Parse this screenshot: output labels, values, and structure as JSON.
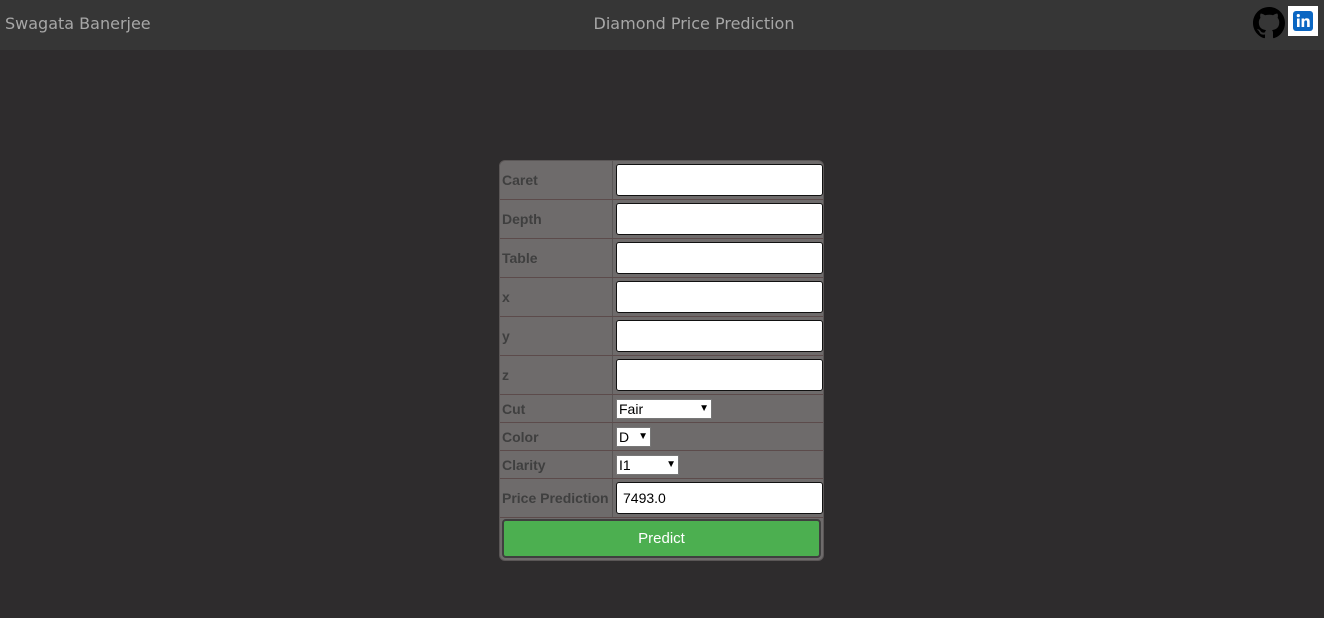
{
  "header": {
    "brand": "Swagata Banerjee",
    "title": "Diamond Price Prediction",
    "icons": [
      "github-icon",
      "linkedin-icon"
    ]
  },
  "form": {
    "fields": [
      {
        "label": "Caret",
        "value": ""
      },
      {
        "label": "Depth",
        "value": ""
      },
      {
        "label": "Table",
        "value": ""
      },
      {
        "label": "x",
        "value": ""
      },
      {
        "label": "y",
        "value": ""
      },
      {
        "label": "z",
        "value": ""
      }
    ],
    "cut": {
      "label": "Cut",
      "selected": "Fair"
    },
    "color": {
      "label": "Color",
      "selected": "D"
    },
    "clarity": {
      "label": "Clarity",
      "selected": "I1"
    },
    "prediction": {
      "label": "Price Prediction",
      "value": "7493.0"
    },
    "predict_label": "Predict"
  },
  "colors": {
    "background": "#2e2c2d",
    "topbar": "#363636",
    "panel": "#6e6b6b",
    "button": "#4caf50",
    "linkedin": "#0a66c2"
  }
}
